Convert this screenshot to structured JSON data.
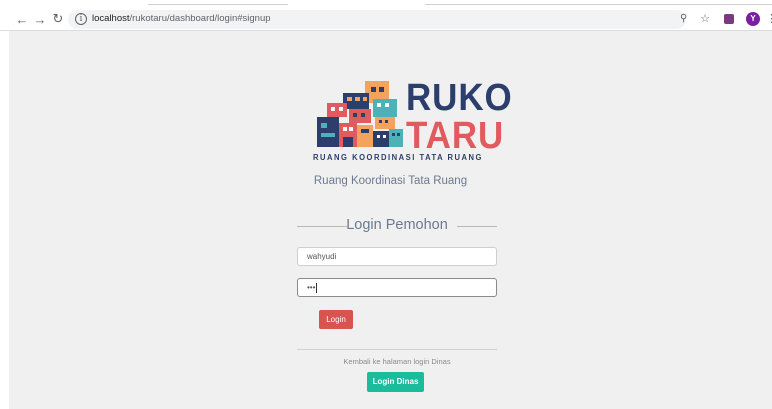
{
  "browser": {
    "url_host": "localhost",
    "url_path": "/rukotaru/dashboard/login#signup",
    "avatar_letter": "Y"
  },
  "logo": {
    "word1": "RUKO",
    "word2": "TARU",
    "tagline": "RUANG KOORDINASI TATA RUANG",
    "colors": {
      "navy": "#2c3e6b",
      "red": "#e05a5e",
      "teal": "#4bb3b8",
      "orange": "#f3a35c"
    }
  },
  "page": {
    "subtitle": "Ruang Koordinasi Tata Ruang",
    "section_title": "Login Pemohon",
    "username_value": "wahyudi",
    "password_value": "•••",
    "login_button": "Login",
    "back_text": "Kembali ke halaman login Dinas",
    "dinas_button": "Login Dinas"
  },
  "colors": {
    "login_button": "#d9534f",
    "dinas_button": "#1abc9c",
    "page_background": "#f0f0f0"
  }
}
